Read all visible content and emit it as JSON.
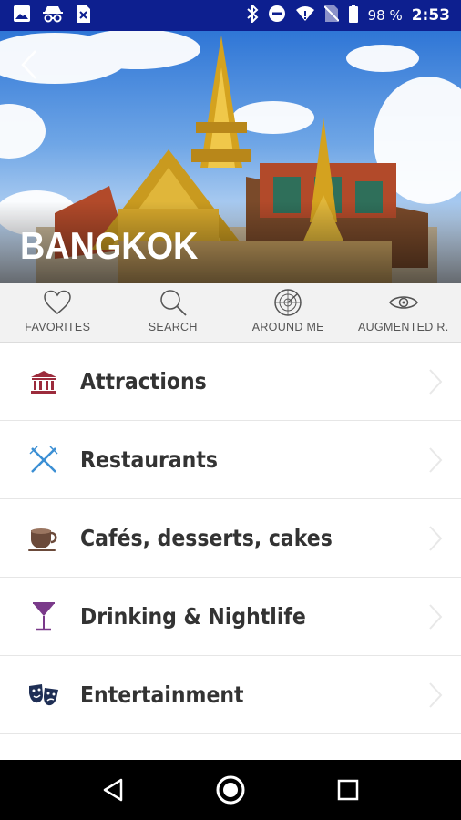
{
  "status_bar": {
    "battery_percent": "98 %",
    "time": "2:53",
    "icons": [
      "image-icon",
      "incognito-icon",
      "sim-error-icon",
      "bluetooth-icon",
      "do-not-disturb-icon",
      "wifi-icon",
      "no-sim-icon",
      "battery-icon"
    ]
  },
  "hero": {
    "title": "BANGKOK"
  },
  "quick_actions": [
    {
      "label": "FAVORITES",
      "icon": "heart-icon"
    },
    {
      "label": "SEARCH",
      "icon": "search-icon"
    },
    {
      "label": "AROUND ME",
      "icon": "radar-icon"
    },
    {
      "label": "AUGMENTED R.",
      "icon": "eye-icon"
    }
  ],
  "categories": [
    {
      "label": "Attractions",
      "icon": "museum-icon"
    },
    {
      "label": "Restaurants",
      "icon": "fork-knife-icon"
    },
    {
      "label": "Cafés, desserts, cakes",
      "icon": "coffee-cup-icon"
    },
    {
      "label": "Drinking & Nightlife",
      "icon": "cocktail-icon"
    },
    {
      "label": "Entertainment",
      "icon": "theater-masks-icon"
    }
  ],
  "colors": {
    "status_bar": "#0d1f8f",
    "attractions_icon": "#9c2b3c",
    "restaurants_icon": "#3b8fd4",
    "cafes_icon": "#6b4a3a",
    "drinking_icon": "#7a3a8a",
    "entertainment_icon": "#1f2f55"
  }
}
